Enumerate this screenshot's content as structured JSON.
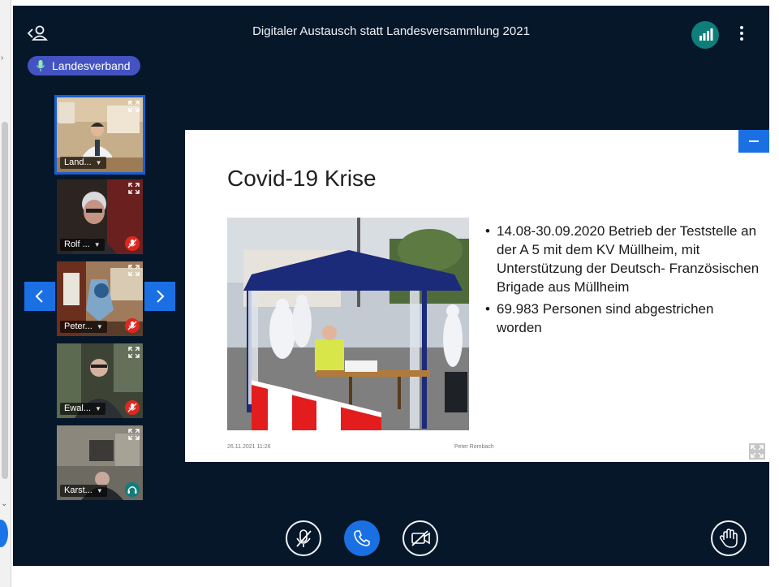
{
  "header": {
    "title": "Digitaler Austausch statt Landesversammlung 2021",
    "icons": {
      "user_list": "user-list-toggle-icon",
      "connection": "signal-bars-icon",
      "more": "vertical-dots-icon"
    }
  },
  "talker": {
    "label": "Landesverband",
    "icon": "microphone-icon"
  },
  "webcams": [
    {
      "name": "Land...",
      "state": "active"
    },
    {
      "name": "Rolf ...",
      "state": "muted"
    },
    {
      "name": "Peter...",
      "state": "muted"
    },
    {
      "name": "Ewal...",
      "state": "muted"
    },
    {
      "name": "Karst...",
      "state": "listen-only"
    }
  ],
  "presentation": {
    "title": "Covid-19 Krise",
    "bullets": [
      "14.08-30.09.2020 Betrieb der Teststelle an der A 5 mit dem KV Müllheim, mit Unterstützung der Deutsch- Französischen Brigade aus Müllheim",
      "69.983 Personen sind abgestrichen worden"
    ],
    "footer_date": "26.11.2021 11:26",
    "footer_author": "Peter Rombach"
  },
  "controls": {
    "mute": "microphone-off-icon",
    "leave_audio": "phone-icon",
    "video": "camera-off-icon",
    "raise_hand": "hand-icon"
  },
  "colors": {
    "app_bg": "#06172a",
    "primary_blue": "#1a70e3",
    "talker_bg": "#4353c1",
    "mute_red": "#df2721",
    "listen_teal": "#0f7d7a"
  }
}
